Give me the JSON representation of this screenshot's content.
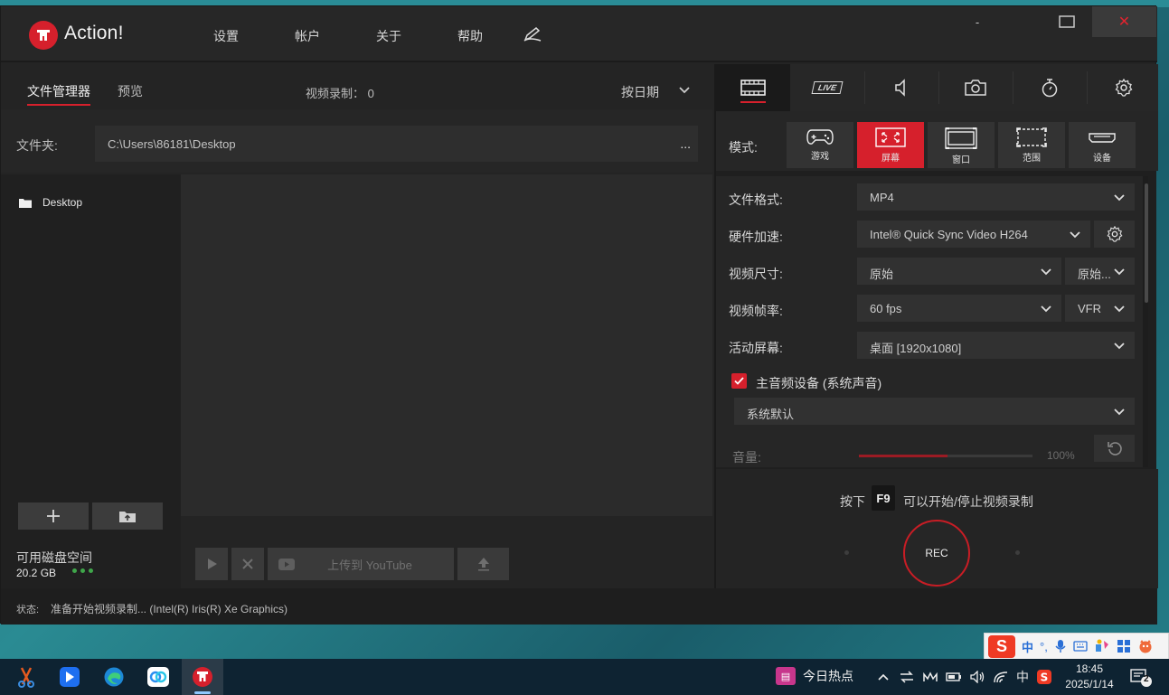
{
  "app": {
    "title": "Action!",
    "menu": [
      "设置",
      "帐户",
      "关于",
      "帮助"
    ],
    "window_controls": {
      "minimize": "-",
      "close": "✕"
    }
  },
  "left": {
    "tabs": [
      "文件管理器",
      "预览"
    ],
    "record_count_label": "视频录制：",
    "record_count": "0",
    "sort_label": "按日期",
    "folder_label": "文件夹:",
    "folder_path": "C:\\Users\\86181\\Desktop",
    "more": "...",
    "tree": [
      {
        "name": "Desktop"
      }
    ],
    "disk_label": "可用磁盘空间",
    "disk_value": "20.2 GB",
    "upload_label": "上传到 YouTube"
  },
  "status": {
    "label": "状态:",
    "text": "准备开始视频录制... (Intel(R) Iris(R) Xe Graphics)"
  },
  "right": {
    "tabs": [
      "video",
      "LIVE",
      "audio",
      "screenshot",
      "timer",
      "settings"
    ],
    "live_label": "LIVE",
    "mode_label": "模式:",
    "modes": [
      "游戏",
      "屏幕",
      "窗口",
      "范围",
      "设备"
    ],
    "active_mode": "屏幕",
    "settings": {
      "format_label": "文件格式:",
      "format_value": "MP4",
      "hw_label": "硬件加速:",
      "hw_value": "Intel® Quick Sync Video H264",
      "size_label": "视频尺寸:",
      "size_value": "原始",
      "size_value2": "原始...",
      "fps_label": "视频帧率:",
      "fps_value": "60 fps",
      "fps_mode": "VFR",
      "screen_label": "活动屏幕:",
      "screen_value": "桌面 [1920x1080]",
      "audio_checkbox_label": "主音频设备 (系统声音)",
      "audio_device": "系统默认",
      "volume_label": "音量:",
      "volume_pct": "100%",
      "volume_fraction": 0.51
    },
    "hint_before": "按下",
    "hint_key": "F9",
    "hint_after": "可以开始/停止视频录制",
    "rec_label": "REC"
  },
  "ime": {
    "lang": "中",
    "punct": "°,"
  },
  "taskbar": {
    "news": "今日热点",
    "tray_lang": "中",
    "time": "18:45",
    "date": "2025/1/14",
    "notifications": "2"
  },
  "colors": {
    "accent": "#d6202c",
    "bg": "#242424",
    "panel": "#1f1f1f"
  }
}
